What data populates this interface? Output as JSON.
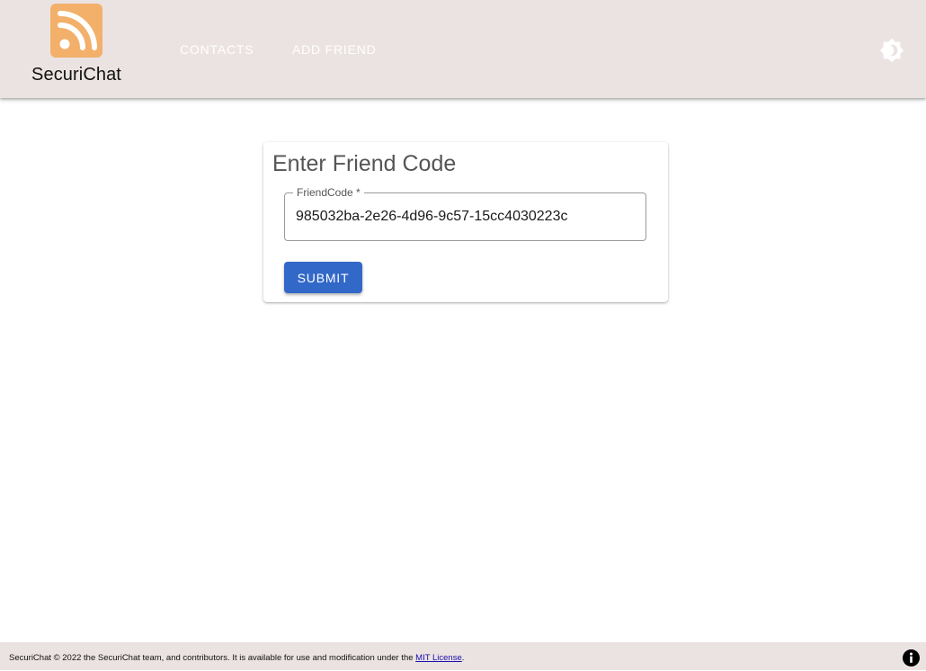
{
  "header": {
    "logo_text": "SecuriChat",
    "logo_icon": "rss-feed-icon",
    "nav": [
      {
        "label": "CONTACTS"
      },
      {
        "label": "ADD FRIEND"
      }
    ],
    "theme_toggle_icon": "brightness-icon",
    "colors": {
      "appbar_bg": "#ebe3e2",
      "logo_bg": "#f2b06a",
      "nav_text": "#ffffff"
    }
  },
  "main": {
    "card": {
      "title": "Enter Friend Code",
      "field": {
        "label": "FriendCode",
        "required_marker": " *",
        "value": "985032ba-2e26-4d96-9c57-15cc4030223c"
      },
      "submit_label": "SUBMIT",
      "submit_color": "#3268c8"
    }
  },
  "footer": {
    "text": "SecuriChat © 2022 the SecuriChat team, and contributors. It is available for use and modification under the ",
    "link_text": "MIT License",
    "suffix": ".",
    "info_icon": "info-icon"
  }
}
